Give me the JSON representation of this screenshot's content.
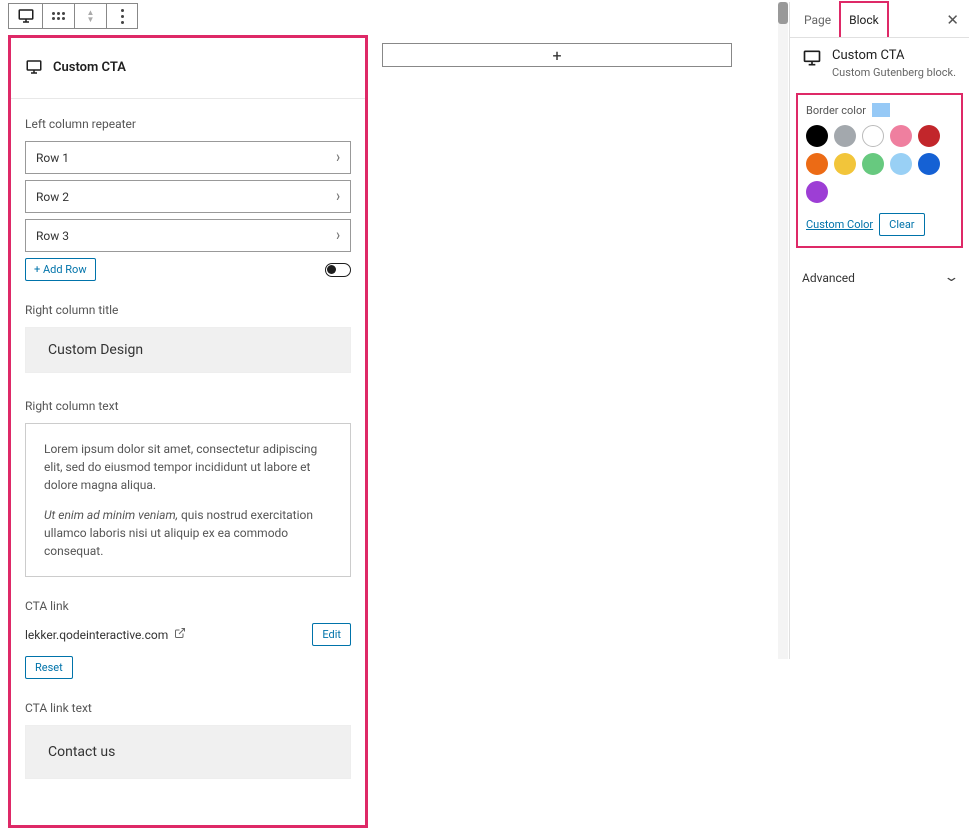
{
  "toolbar": {
    "icons": [
      "desktop-view",
      "drag-handle",
      "move-up-down",
      "more-options"
    ]
  },
  "block_editor": {
    "title": "Custom CTA",
    "left_repeater": {
      "label": "Left column repeater",
      "rows": [
        "Row 1",
        "Row 2",
        "Row 3"
      ],
      "add_row_label": "+ Add Row"
    },
    "right_title": {
      "label": "Right column title",
      "value": "Custom Design"
    },
    "right_text": {
      "label": "Right column text",
      "paragraph1_plain": "Lorem ipsum dolor sit amet, consectetur adipiscing elit, sed do eiusmod tempor incididunt ut labore et dolore magna aliqua.",
      "paragraph2_em": "Ut enim ad minim veniam,",
      "paragraph2_rest": " quis nostrud exercitation ullamco laboris nisi ut aliquip ex ea commodo consequat."
    },
    "cta_link": {
      "label": "CTA link",
      "url": "lekker.qodeinteractive.com",
      "edit_label": "Edit",
      "reset_label": "Reset"
    },
    "cta_link_text": {
      "label": "CTA link text",
      "value": "Contact us"
    }
  },
  "add_block_plus": "+",
  "sidebar": {
    "tabs": {
      "page": "Page",
      "block": "Block"
    },
    "block_info": {
      "name": "Custom CTA",
      "sub": "Custom Gutenberg block."
    },
    "border_color": {
      "label": "Border color",
      "selected": "#96c9f6",
      "swatches": [
        {
          "hex": "#000000",
          "bordered": false
        },
        {
          "hex": "#a3a8ad",
          "bordered": false
        },
        {
          "hex": "#ffffff",
          "bordered": true
        },
        {
          "hex": "#ef7f9f",
          "bordered": false
        },
        {
          "hex": "#c2262b",
          "bordered": false
        },
        {
          "hex": "#ec6b15",
          "bordered": false
        },
        {
          "hex": "#f2c53a",
          "bordered": false
        },
        {
          "hex": "#67c97f",
          "bordered": false
        },
        {
          "hex": "#99d0f5",
          "bordered": false
        },
        {
          "hex": "#1561d4",
          "bordered": false
        },
        {
          "hex": "#9d3ed5",
          "bordered": false
        }
      ],
      "custom_label": "Custom Color",
      "clear_label": "Clear"
    },
    "advanced_label": "Advanced"
  }
}
